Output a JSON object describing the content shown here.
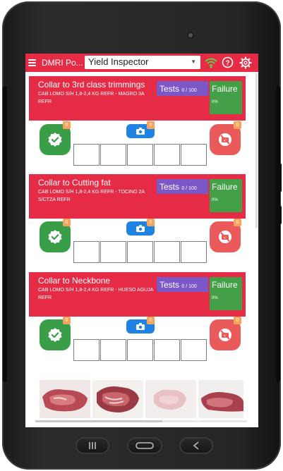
{
  "topbar": {
    "app_title": "DMRI Po...",
    "selected_tool": "Yield Inspector",
    "icons": [
      "menu-icon",
      "wifi-icon",
      "help-icon",
      "gear-icon"
    ]
  },
  "cards": [
    {
      "title": "Collar to 3rd class trimmings",
      "description": "CAB LOMO S/H 1,8-2,4 KG REFR - MAGRO 3A REFR",
      "tests_label": "Tests",
      "tests_count": "0 / 100",
      "failure_label": "Failure",
      "failure_pct": "0%",
      "ok_count": "0",
      "photo_count": "0",
      "reject_count": "0"
    },
    {
      "title": "Collar to Cutting fat",
      "description": "CAB LOMO S/H 1,8-2,4 KG REFR - TOCINO 2A S/CTZA REFR",
      "tests_label": "Tests",
      "tests_count": "0 / 100",
      "failure_label": "Failure",
      "failure_pct": "0%",
      "ok_count": "0",
      "photo_count": "0",
      "reject_count": "0"
    },
    {
      "title": "Collar to Neckbone",
      "description": "CAB LOMO S/H 1,8-2,4 KG REFR - HUESO AGUJA REFR",
      "tests_label": "Tests",
      "tests_count": "0 / 100",
      "failure_label": "Failure",
      "failure_pct": "0%",
      "ok_count": "0",
      "photo_count": "0",
      "reject_count": "0"
    }
  ],
  "gallery": {
    "thumbnails": [
      "meat-photo-1",
      "meat-photo-2",
      "meat-photo-3",
      "meat-photo-4"
    ]
  },
  "colors": {
    "brand_red": "#e52b46",
    "tests_purple": "#7b57c8",
    "failure_green": "#43a047",
    "ok_green": "#3a9e48",
    "reject_red": "#ea5a5a",
    "camera_blue": "#1f83e4",
    "badge_orange": "#f7a35b"
  }
}
